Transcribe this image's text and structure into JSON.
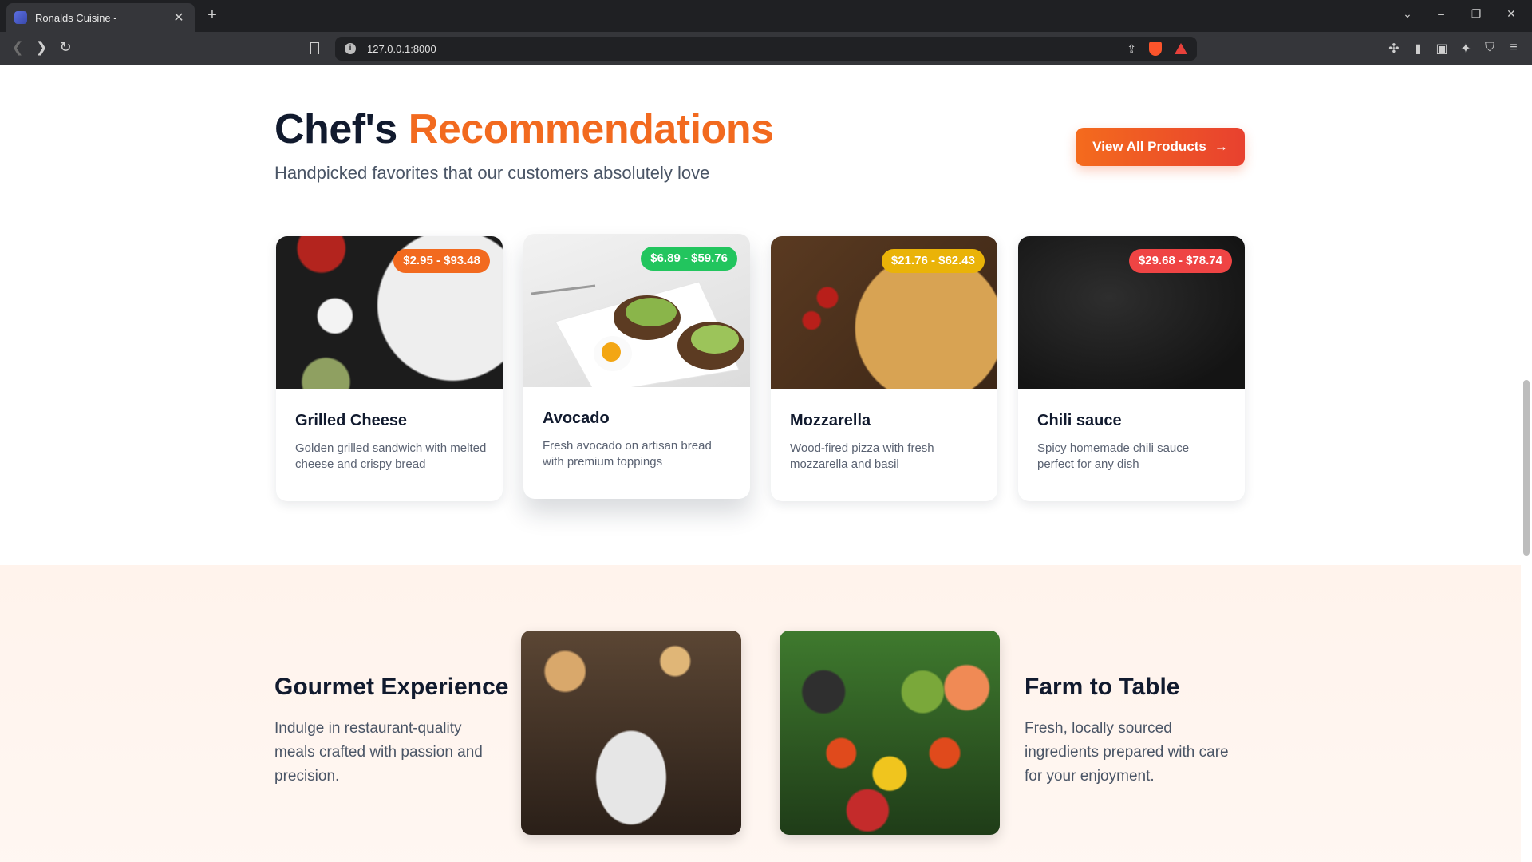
{
  "browser": {
    "tab_title": "Ronalds Cuisine -",
    "url": "127.0.0.1:8000"
  },
  "section": {
    "title_main": "Chef's",
    "title_accent": "Recommendations",
    "subtitle": "Handpicked favorites that our customers absolutely love",
    "view_all_label": "View All Products",
    "view_all_arrow": "→"
  },
  "products": [
    {
      "name": "Grilled Cheese",
      "price": "$2.95 - $93.48",
      "badge_color": "#f26a1f",
      "description": "Golden grilled sandwich with melted cheese and crispy bread"
    },
    {
      "name": "Avocado",
      "price": "$6.89 - $59.76",
      "badge_color": "#22c55e",
      "description": "Fresh avocado on artisan bread with premium toppings"
    },
    {
      "name": "Mozzarella",
      "price": "$21.76 - $62.43",
      "badge_color": "#eab308",
      "description": "Wood-fired pizza with fresh mozzarella and basil"
    },
    {
      "name": "Chili sauce",
      "price": "$29.68 - $78.74",
      "badge_color": "#ef4444",
      "description": "Spicy homemade chili sauce perfect for any dish"
    }
  ],
  "features": [
    {
      "title": "Gourmet Experience",
      "text": "Indulge in restaurant-quality meals crafted with passion and precision."
    },
    {
      "title": "Farm to Table",
      "text": "Fresh, locally sourced ingredients prepared with care for your enjoyment."
    }
  ],
  "colors": {
    "accent": "#f26a1f",
    "heading": "#111a2e"
  }
}
